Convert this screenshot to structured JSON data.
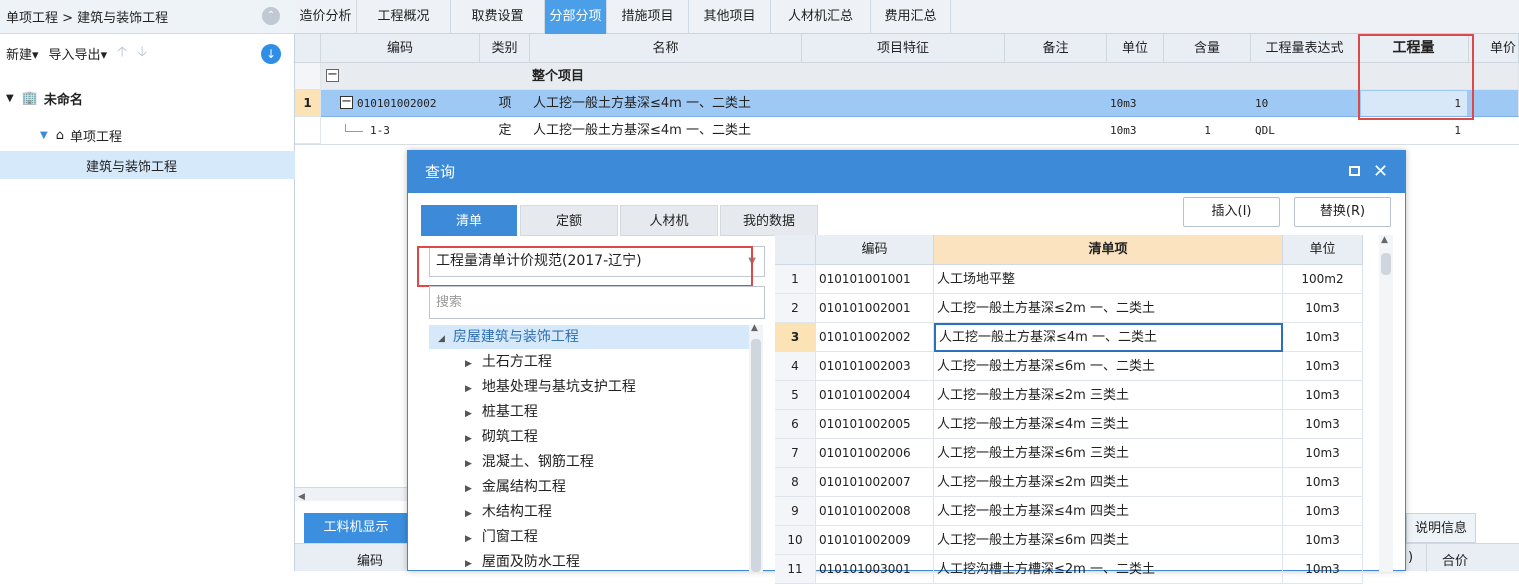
{
  "left_panel": {
    "breadcrumb": "单项工程 > 建筑与装饰工程",
    "toolbar": {
      "new_label": "新建",
      "import_export_label": "导入导出"
    },
    "tree": [
      {
        "label": "未命名"
      },
      {
        "label": "单项工程"
      },
      {
        "label": "建筑与装饰工程"
      }
    ]
  },
  "tabs": [
    "造价分析",
    "工程概况",
    "取费设置",
    "分部分项",
    "措施项目",
    "其他项目",
    "人材机汇总",
    "费用汇总"
  ],
  "active_tab": "分部分项",
  "grid": {
    "headers": [
      "编码",
      "类别",
      "名称",
      "项目特征",
      "备注",
      "单位",
      "含量",
      "工程量表达式",
      "工程量",
      "单价"
    ],
    "group_row": {
      "name": "整个项目"
    },
    "rows": [
      {
        "num": "1",
        "code": "010101002002",
        "type": "项",
        "name": "人工挖一般土方基深≤4m 一、二类土",
        "unit": "10m3",
        "content": "",
        "expr": "10",
        "qty": "1"
      },
      {
        "num": "",
        "code": "1-3",
        "type": "定",
        "name": "人工挖一般土方基深≤4m 一、二类土",
        "unit": "10m3",
        "content": "1",
        "expr": "QDL",
        "qty": "1"
      }
    ]
  },
  "bottom": {
    "material_tab": "工料机显示",
    "code_col": "编码",
    "info_tab": "说明信息",
    "total_col": "合价",
    "partial_col": ")"
  },
  "dialog": {
    "title": "查询",
    "tabs": [
      "清单",
      "定额",
      "人材机",
      "我的数据"
    ],
    "active_tab": "清单",
    "insert_button": "插入(I)",
    "replace_button": "替换(R)",
    "spec_select": "工程量清单计价规范(2017-辽宁)",
    "search_placeholder": "搜索",
    "tree_root": "房屋建筑与装饰工程",
    "tree_items": [
      "土石方工程",
      "地基处理与基坑支护工程",
      "桩基工程",
      "砌筑工程",
      "混凝土、钢筋工程",
      "金属结构工程",
      "木结构工程",
      "门窗工程",
      "屋面及防水工程"
    ],
    "table_headers": [
      "编码",
      "清单项",
      "单位"
    ],
    "rows": [
      {
        "num": "1",
        "code": "010101001001",
        "name": "人工场地平整",
        "unit": "100m2"
      },
      {
        "num": "2",
        "code": "010101002001",
        "name": "人工挖一般土方基深≤2m 一、二类土",
        "unit": "10m3"
      },
      {
        "num": "3",
        "code": "010101002002",
        "name": "人工挖一般土方基深≤4m 一、二类土",
        "unit": "10m3"
      },
      {
        "num": "4",
        "code": "010101002003",
        "name": "人工挖一般土方基深≤6m 一、二类土",
        "unit": "10m3"
      },
      {
        "num": "5",
        "code": "010101002004",
        "name": "人工挖一般土方基深≤2m 三类土",
        "unit": "10m3"
      },
      {
        "num": "6",
        "code": "010101002005",
        "name": "人工挖一般土方基深≤4m 三类土",
        "unit": "10m3"
      },
      {
        "num": "7",
        "code": "010101002006",
        "name": "人工挖一般土方基深≤6m 三类土",
        "unit": "10m3"
      },
      {
        "num": "8",
        "code": "010101002007",
        "name": "人工挖一般土方基深≤2m 四类土",
        "unit": "10m3"
      },
      {
        "num": "9",
        "code": "010101002008",
        "name": "人工挖一般土方基深≤4m 四类土",
        "unit": "10m3"
      },
      {
        "num": "10",
        "code": "010101002009",
        "name": "人工挖一般土方基深≤6m 四类土",
        "unit": "10m3"
      },
      {
        "num": "11",
        "code": "010101003001",
        "name": "人工挖沟槽土方槽深≤2m 一、二类土",
        "unit": "10m3"
      }
    ]
  },
  "colors": {
    "accent": "#3d8bd8",
    "highlight": "#e04848",
    "selected": "#d6e9fb",
    "orange_header": "#fbe3c0"
  }
}
